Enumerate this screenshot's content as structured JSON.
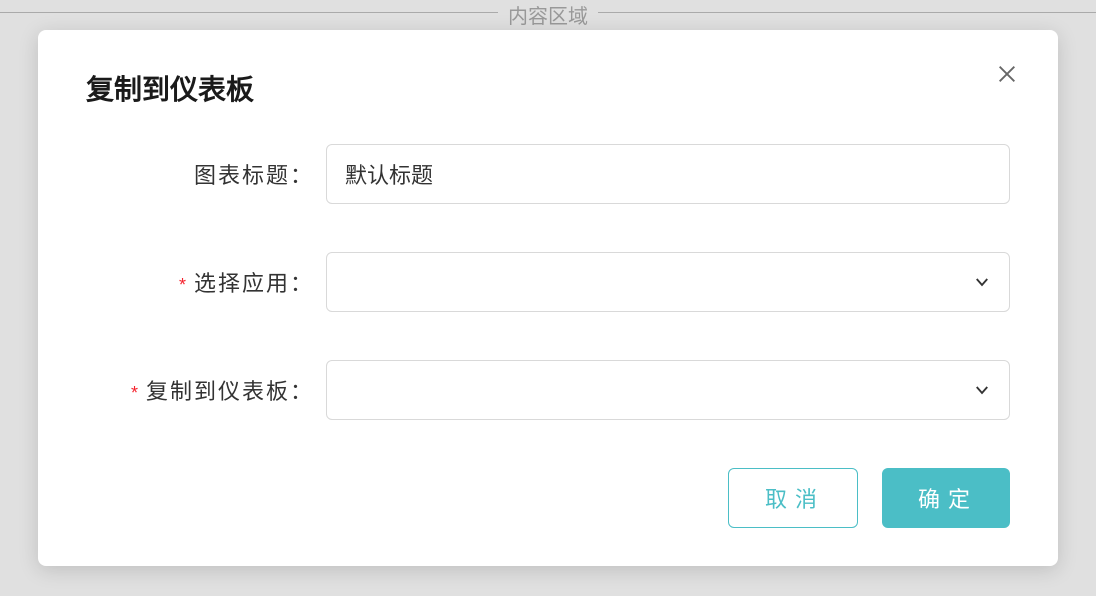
{
  "background": {
    "header_text": "内容区域"
  },
  "modal": {
    "title": "复制到仪表板",
    "fields": {
      "chart_title": {
        "label": "图表标题：",
        "value": "默认标题"
      },
      "select_app": {
        "label": "选择应用：",
        "required": "*",
        "value": ""
      },
      "copy_to_dashboard": {
        "label": "复制到仪表板：",
        "required": "*",
        "value": ""
      }
    },
    "actions": {
      "cancel": "取消",
      "confirm": "确定"
    }
  }
}
